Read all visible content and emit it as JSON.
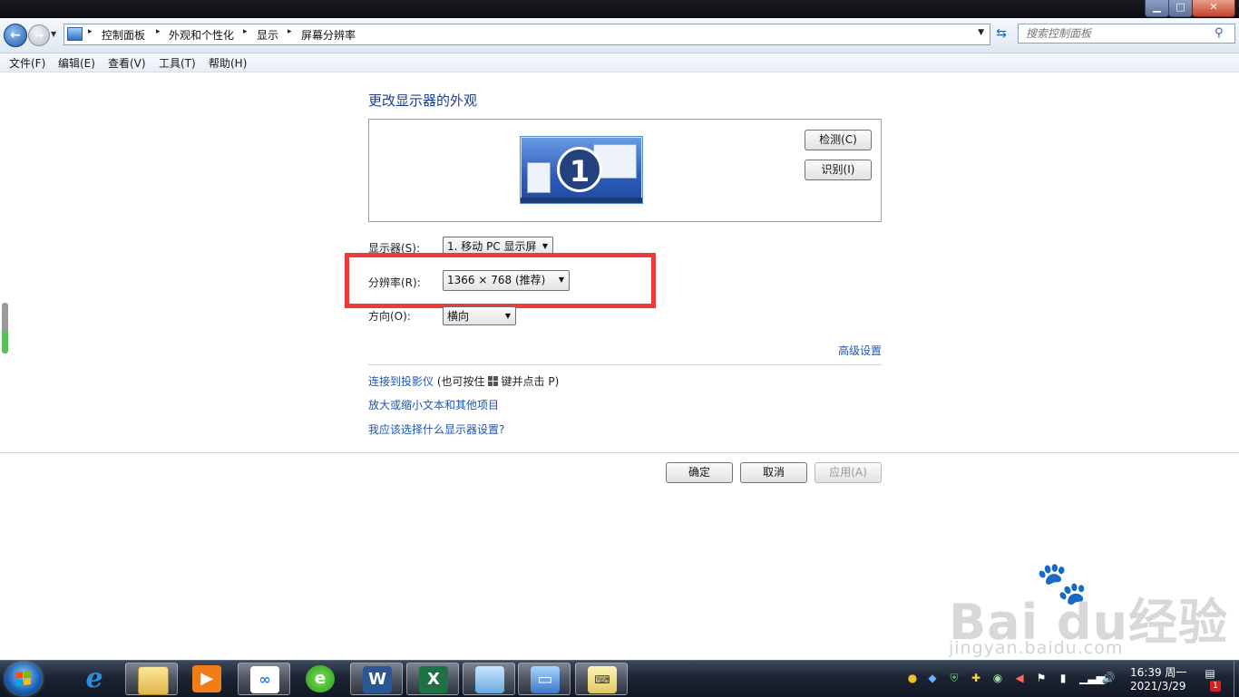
{
  "window": {
    "min_glyph": "▁",
    "max_glyph": "□",
    "close_glyph": "✕"
  },
  "breadcrumb": {
    "items": [
      "控制面板",
      "外观和个性化",
      "显示",
      "屏幕分辨率"
    ],
    "separator": "▸"
  },
  "search": {
    "placeholder": "搜索控制面板"
  },
  "menu": {
    "items": [
      "文件(F)",
      "编辑(E)",
      "查看(V)",
      "工具(T)",
      "帮助(H)"
    ]
  },
  "main": {
    "heading": "更改显示器的外观",
    "monitor_number": "1",
    "detect_label": "检测(C)",
    "identify_label": "识别(I)",
    "display_label": "显示器(S):",
    "display_value": "1. 移动 PC 显示屏",
    "resolution_label": "分辨率(R):",
    "resolution_value": "1366 × 768 (推荐)",
    "orientation_label": "方向(O):",
    "orientation_value": "横向",
    "advanced_link": "高级设置",
    "projector_link": "连接到投影仪",
    "projector_hint_before": "(也可按住",
    "projector_hint_after": "键并点击 P)",
    "text_size_link": "放大或缩小文本和其他项目",
    "which_settings_link": "我应该选择什么显示器设置?"
  },
  "footer": {
    "ok_label": "确定",
    "cancel_label": "取消",
    "apply_label": "应用(A)"
  },
  "watermark": {
    "logo_text": "Bai  du经验",
    "url": "jingyan.baidu.com"
  },
  "taskbar": {
    "apps": [
      {
        "name": "internet-explorer",
        "glyph": "e"
      },
      {
        "name": "file-explorer",
        "glyph": ""
      },
      {
        "name": "media-player",
        "glyph": "▶"
      },
      {
        "name": "baidu-netdisk",
        "glyph": "∞"
      },
      {
        "name": "360-browser",
        "glyph": "e"
      },
      {
        "name": "word",
        "glyph": "W"
      },
      {
        "name": "excel",
        "glyph": "X"
      },
      {
        "name": "sticky-note",
        "glyph": ""
      },
      {
        "name": "display-settings",
        "glyph": "▭"
      },
      {
        "name": "keyboard",
        "glyph": "⌨"
      }
    ],
    "clock_time": "16:39 周一",
    "clock_date": "2021/3/29",
    "notification_count": "1"
  }
}
